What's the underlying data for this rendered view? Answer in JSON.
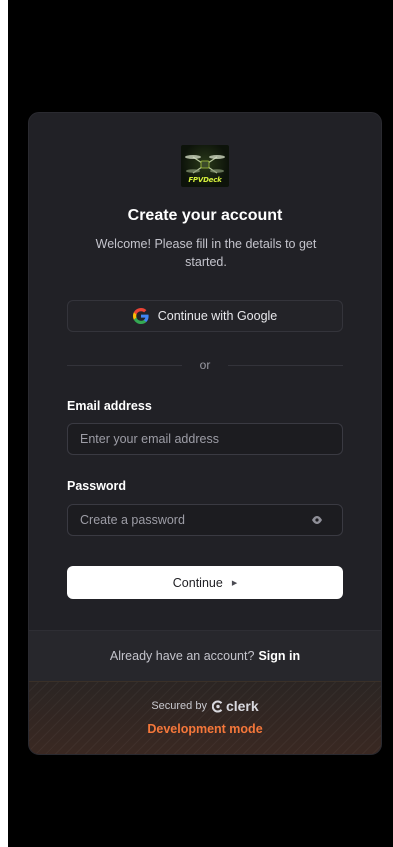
{
  "brand": {
    "logo_text": "FPVDeck"
  },
  "header": {
    "title": "Create your account",
    "subtitle": "Welcome! Please fill in the details to get started."
  },
  "social": {
    "google_label": "Continue with Google"
  },
  "divider": {
    "text": "or"
  },
  "form": {
    "email_label": "Email address",
    "email_placeholder": "Enter your email address",
    "email_value": "",
    "password_label": "Password",
    "password_placeholder": "Create a password",
    "password_value": "",
    "continue_label": "Continue"
  },
  "footer": {
    "signin_prompt": "Already have an account?",
    "signin_link": "Sign in",
    "secured_by": "Secured by",
    "clerk_name": "clerk",
    "dev_mode": "Development mode"
  },
  "colors": {
    "background": "#000000",
    "card": "#212126",
    "button_primary": "#ffffff",
    "dev_accent": "#f5773a"
  },
  "icons": [
    "google-icon",
    "eye-icon",
    "play-arrow-icon",
    "clerk-icon",
    "drone-logo"
  ]
}
